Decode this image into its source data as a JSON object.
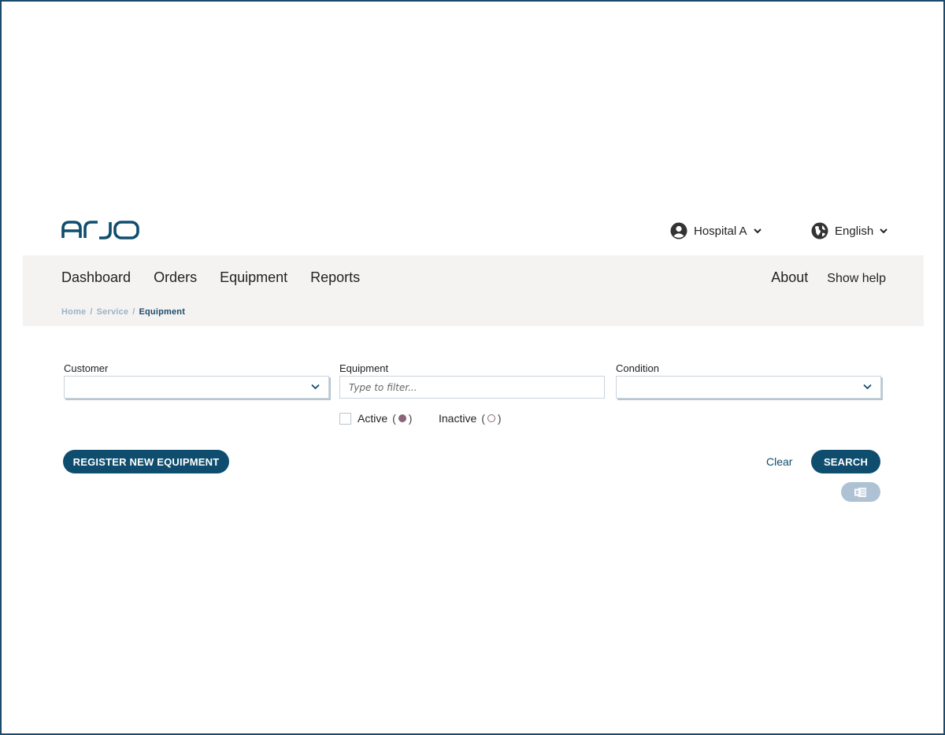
{
  "brand": {
    "logo_text": "arjo",
    "brand_color": "#0f4d6e"
  },
  "header": {
    "account": {
      "label": "Hospital A",
      "icon": "user-circle-icon"
    },
    "language": {
      "label": "English",
      "icon": "globe-icon"
    }
  },
  "nav": {
    "items": [
      {
        "label": "Dashboard"
      },
      {
        "label": "Orders"
      },
      {
        "label": "Equipment"
      },
      {
        "label": "Reports"
      }
    ],
    "about": "About",
    "help": "Show help"
  },
  "breadcrumb": {
    "items": [
      "Home",
      "Service"
    ],
    "separator": "/",
    "current": "Equipment"
  },
  "filters": {
    "customer": {
      "label": "Customer",
      "value": ""
    },
    "equipment": {
      "label": "Equipment",
      "placeholder": "Type to filter...",
      "value": ""
    },
    "condition": {
      "label": "Condition",
      "value": ""
    },
    "status_checkbox_checked": false,
    "legend_active": "Active",
    "legend_inactive": "Inactive"
  },
  "actions": {
    "register": "REGISTER NEW EQUIPMENT",
    "clear": "Clear",
    "search": "SEARCH",
    "export_icon": "excel-icon"
  },
  "colors": {
    "nav_background": "#f5f3f2",
    "status_dot": "#8a6478",
    "excel_button": "#aec2d4",
    "breadcrumb_link": "#9ab3c6"
  }
}
